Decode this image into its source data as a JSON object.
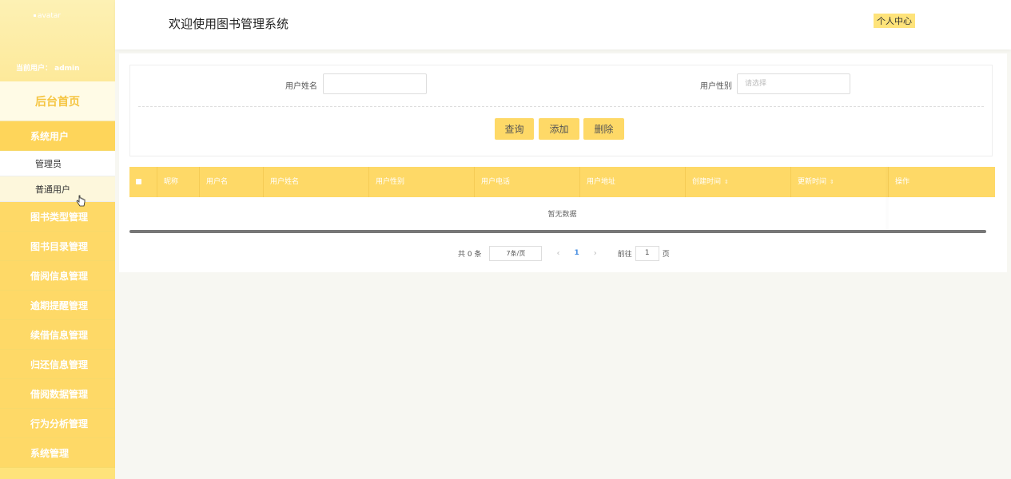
{
  "sidebar": {
    "avatar_text": "avatar",
    "current_user": "当前用户：  admin",
    "home": "后台首页",
    "group_system_users": "系统用户",
    "sub_admin": "管理员",
    "sub_normal": "普通用户",
    "groups": [
      "图书类型管理",
      "图书目录管理",
      "借阅信息管理",
      "逾期提醒管理",
      "续借信息管理",
      "归还信息管理",
      "借阅数据管理",
      "行为分析管理",
      "系统管理"
    ]
  },
  "header": {
    "title": "欢迎使用图书管理系统",
    "user_center": "个人中心"
  },
  "search": {
    "name_label": "用户姓名",
    "name_value": "",
    "gender_label": "用户性别",
    "gender_placeholder": "请选择",
    "query_btn": "查询",
    "add_btn": "添加",
    "delete_btn": "删除"
  },
  "table": {
    "columns": [
      "昵称",
      "用户名",
      "用户姓名",
      "用户性别",
      "用户电话",
      "用户地址",
      "创建时间",
      "更新时间",
      "操作"
    ],
    "empty_text": "暂无数据"
  },
  "pager": {
    "total": "共 0 条",
    "page_size": "7条/页",
    "prev": "‹",
    "current": "1",
    "next": "›",
    "goto_label": "前往",
    "goto_value": "1",
    "goto_suffix": "页"
  },
  "colors": {
    "accent": "#fed967",
    "sidebar": "#fee37a",
    "home_text": "#f5c542"
  }
}
